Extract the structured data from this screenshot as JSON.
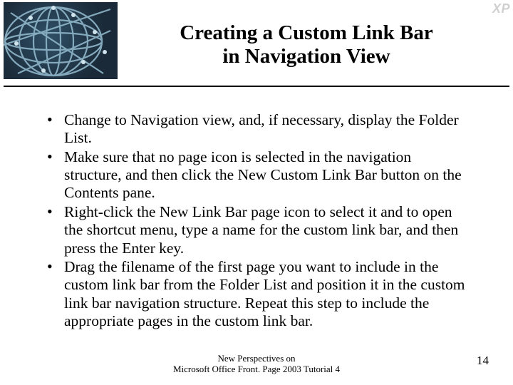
{
  "badge": "XP",
  "title_line1": "Creating a Custom Link Bar",
  "title_line2": "in Navigation View",
  "bullets": [
    "Change to Navigation view, and, if necessary, display the Folder List.",
    "Make sure that no page icon is selected in the navigation structure, and then click the New Custom Link Bar button on the Contents pane.",
    "Right-click the New Link Bar page icon to select it and to open the shortcut menu, type a name for the custom link bar, and then press the Enter key.",
    "Drag the filename of the first page you want to include in the custom link bar from the Folder List and position it in the custom link bar navigation structure. Repeat this step to include the appropriate pages in the custom link bar."
  ],
  "footer_line1": "New Perspectives on",
  "footer_line2": "Microsoft Office Front. Page 2003 Tutorial 4",
  "page_number": "14"
}
